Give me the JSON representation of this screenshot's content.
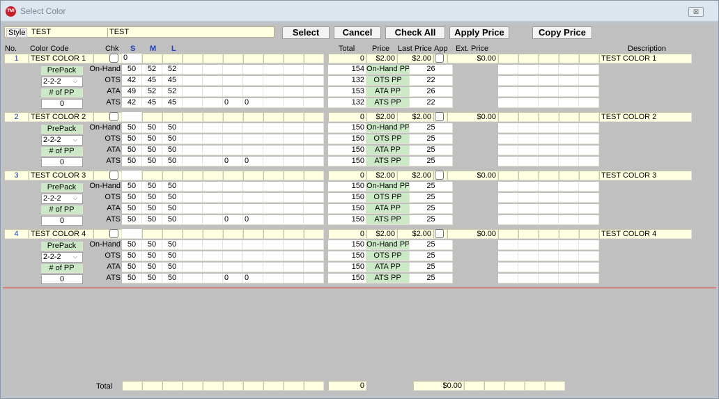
{
  "window": {
    "title": "Select Color",
    "app_icon_text": "TMI",
    "close_glyph": "☒"
  },
  "style": {
    "label": "Style",
    "code": "TEST",
    "description": "TEST"
  },
  "buttons": {
    "select": "Select",
    "cancel": "Cancel",
    "check_all": "Check All",
    "apply_price": "Apply Price",
    "copy_price": "Copy Price"
  },
  "headers": {
    "no": "No.",
    "color_code": "Color Code",
    "chk": "Chk",
    "sizes": [
      "S",
      "M",
      "L"
    ],
    "total": "Total",
    "price": "Price",
    "last_price": "Last Price",
    "app": "App",
    "ext_price": "Ext. Price",
    "description": "Description"
  },
  "labels": {
    "prepack": "PrePack",
    "num_pp": "# of PP",
    "dropdown_glyph": "⌵",
    "on_hand": "On-Hand",
    "ots": "OTS",
    "ata": "ATA",
    "ats": "ATS",
    "on_hand_pp": "On-Hand PP",
    "ots_pp": "OTS PP",
    "ata_pp": "ATA PP",
    "ats_pp": "ATS PP",
    "total": "Total"
  },
  "colors": [
    {
      "no": "1",
      "code": "TEST COLOR 1",
      "entry": "0",
      "total": "0",
      "price": "$2.00",
      "last_price": "$2.00",
      "ext_price": "$0.00",
      "description": "TEST COLOR 1",
      "prepack": "2-2-2",
      "num_pp": "0",
      "on_hand": [
        "50",
        "52",
        "52"
      ],
      "on_hand_total": "154",
      "on_hand_pp": "26",
      "ots": [
        "42",
        "45",
        "45"
      ],
      "ots_total": "132",
      "ots_pp": "22",
      "ata": [
        "49",
        "52",
        "52"
      ],
      "ata_total": "153",
      "ata_pp": "26",
      "ats": [
        "42",
        "45",
        "45"
      ],
      "ats_extra": [
        "0",
        "0"
      ],
      "ats_total": "132",
      "ats_pp": "22"
    },
    {
      "no": "2",
      "code": "TEST COLOR 2",
      "entry": "",
      "total": "0",
      "price": "$2.00",
      "last_price": "$2.00",
      "ext_price": "$0.00",
      "description": "TEST COLOR 2",
      "prepack": "2-2-2",
      "num_pp": "0",
      "on_hand": [
        "50",
        "50",
        "50"
      ],
      "on_hand_total": "150",
      "on_hand_pp": "25",
      "ots": [
        "50",
        "50",
        "50"
      ],
      "ots_total": "150",
      "ots_pp": "25",
      "ata": [
        "50",
        "50",
        "50"
      ],
      "ata_total": "150",
      "ata_pp": "25",
      "ats": [
        "50",
        "50",
        "50"
      ],
      "ats_extra": [
        "0",
        "0"
      ],
      "ats_total": "150",
      "ats_pp": "25"
    },
    {
      "no": "3",
      "code": "TEST COLOR 3",
      "entry": "",
      "total": "0",
      "price": "$2.00",
      "last_price": "$2.00",
      "ext_price": "$0.00",
      "description": "TEST COLOR 3",
      "prepack": "2-2-2",
      "num_pp": "0",
      "on_hand": [
        "50",
        "50",
        "50"
      ],
      "on_hand_total": "150",
      "on_hand_pp": "25",
      "ots": [
        "50",
        "50",
        "50"
      ],
      "ots_total": "150",
      "ots_pp": "25",
      "ata": [
        "50",
        "50",
        "50"
      ],
      "ata_total": "150",
      "ata_pp": "25",
      "ats": [
        "50",
        "50",
        "50"
      ],
      "ats_extra": [
        "0",
        "0"
      ],
      "ats_total": "150",
      "ats_pp": "25"
    },
    {
      "no": "4",
      "code": "TEST COLOR 4",
      "entry": "",
      "total": "0",
      "price": "$2.00",
      "last_price": "$2.00",
      "ext_price": "$0.00",
      "description": "TEST COLOR 4",
      "prepack": "2-2-2",
      "num_pp": "0",
      "on_hand": [
        "50",
        "50",
        "50"
      ],
      "on_hand_total": "150",
      "on_hand_pp": "25",
      "ots": [
        "50",
        "50",
        "50"
      ],
      "ots_total": "150",
      "ots_pp": "25",
      "ata": [
        "50",
        "50",
        "50"
      ],
      "ata_total": "150",
      "ata_pp": "25",
      "ats": [
        "50",
        "50",
        "50"
      ],
      "ats_extra": [
        "0",
        "0"
      ],
      "ats_total": "150",
      "ats_pp": "25"
    }
  ],
  "footer": {
    "label": "Total",
    "qty_total": "0",
    "ext_total": "$0.00"
  }
}
